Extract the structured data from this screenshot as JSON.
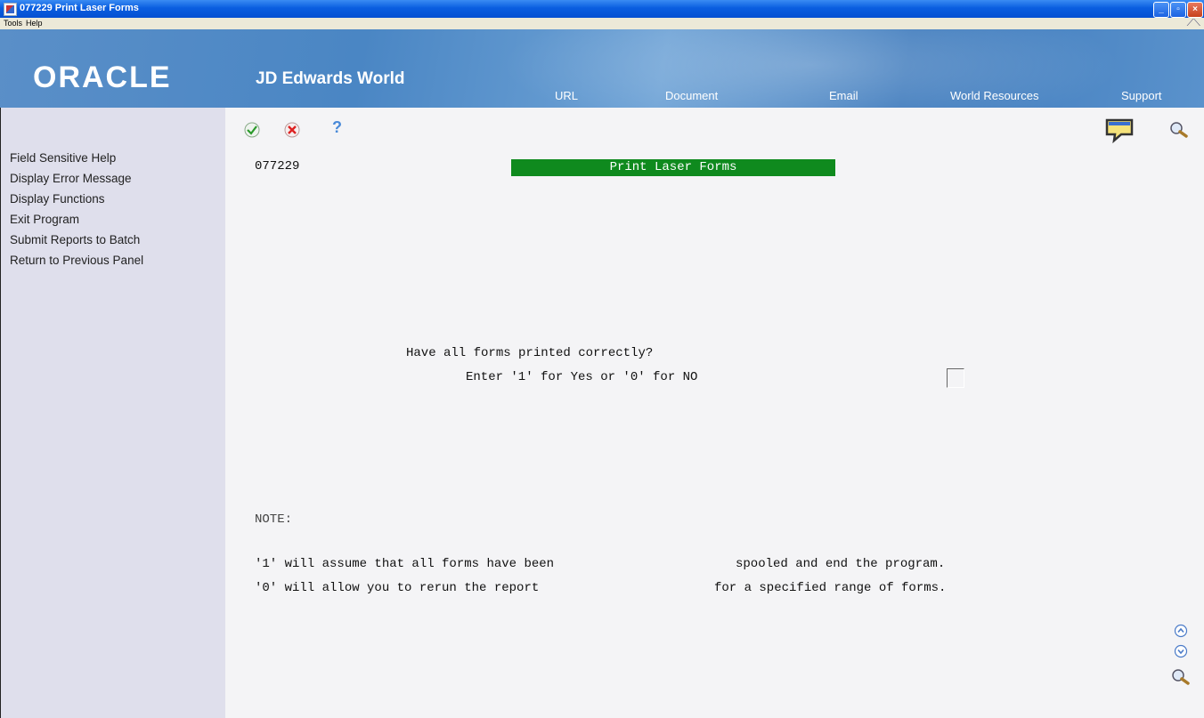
{
  "window": {
    "title": "077229   Print Laser Forms"
  },
  "menubar": {
    "tools": "Tools",
    "help": "Help"
  },
  "banner": {
    "brand": "ORACLE",
    "product": "JD Edwards World",
    "links": [
      "URL",
      "Document",
      "Email",
      "World Resources",
      "Support"
    ]
  },
  "toolbar": {
    "icons": [
      "ok-check-icon",
      "cancel-x-icon",
      "help-question-icon",
      "chat-bubble-icon",
      "search-icon"
    ],
    "help_glyph": "?"
  },
  "sidebar": {
    "items": [
      "Field Sensitive Help",
      "Display Error Message",
      "Display Functions",
      "Exit Program",
      "Submit Reports to Batch",
      "Return to Previous Panel"
    ]
  },
  "form": {
    "program_id": "077229",
    "title": "Print Laser Forms",
    "question": "Have all forms printed correctly?",
    "instruction": "Enter '1' for Yes or '0' for NO",
    "answer_value": "",
    "note_label": "NOTE:",
    "note_line1_a": "'1' will assume that all forms have been",
    "note_line1_b": "spooled and end the program.",
    "note_line2_a": "'0' will allow you to rerun the report",
    "note_line2_b": "for a specified range of forms."
  },
  "colors": {
    "title_bar": "#0a5ee0",
    "form_title_bg": "#0f8a1e",
    "sidebar_bg": "#dfdfec"
  }
}
